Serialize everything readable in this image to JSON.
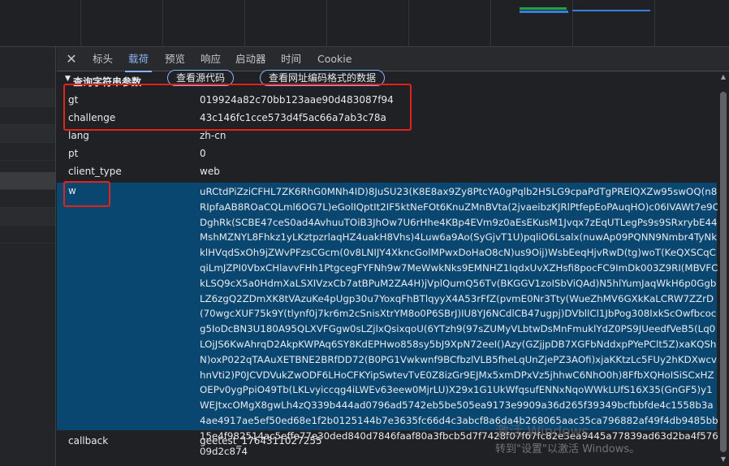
{
  "devtools": {
    "close_icon": "close-icon",
    "tabs": [
      {
        "label": "标头",
        "active": false
      },
      {
        "label": "载荷",
        "active": true
      },
      {
        "label": "预览",
        "active": false
      },
      {
        "label": "响应",
        "active": false
      },
      {
        "label": "启动器",
        "active": false
      },
      {
        "label": "时间",
        "active": false
      },
      {
        "label": "Cookie",
        "active": false
      }
    ]
  },
  "payload": {
    "section_title": "查询字符串参数",
    "view_source_label": "查看源代码",
    "view_url_encoded_label": "查看网址编码格式的数据",
    "params": [
      {
        "key": "gt",
        "value": "019924a82c70bb123aae90d483087f94"
      },
      {
        "key": "challenge",
        "value": "43c146fc1cce573d4f5ac66a7ab3c78a"
      },
      {
        "key": "lang",
        "value": "zh-cn"
      },
      {
        "key": "pt",
        "value": "0"
      },
      {
        "key": "client_type",
        "value": "web"
      },
      {
        "key": "w",
        "value": "uRCtdPiZziCFHL7ZK6RhG0MNh4ID)8JuSU23(K8E8ax9Zy8PtcYA0gPqlb2H5LG9cpaPdTgPRElQXZw95swOQ(n8RIpfaAB8ROaCQLml6OG7L)eGolIQptIt2IF5ktNeFOt6KnuZMnBVta(2jvaeibzKJRlPtfepEoPAuqHO)c06IVAWt7e9CDghRk(SCBE47ceS0ad4AvhuuTOiB3JhOw7U6rHhe4KBp4EVm9z0aEsEKusM1Jvqx7zEqUTLegPs9s9SRxrybE44MshMZNYL8Fhkz1yLKztpzrlaqHZ4uakH8Vhs)4Luw6a9Ao(SyGjvT1U)pqliO6Lsalx(nuwAp09PQNN9Nmbr4TyNkklHVqdSxOh9jZWvPFzsCGcm(0v8LNIJY4XkncGolMPwxDoHaO8cN)us9Oij)WsbEeqHjvRwD(tg)woT(KeQXSCqCqiLmJZPI0VbxCHlavvFHh1PtgcegFYFNh9w7MeWwkNks9EMNHZ1IqdxUvXZHsfi8pocFC9ImDk003Z9RI(MBVFCkLSQ9cX5a0HdmXaLSXIVzxCb7atBPuM2ZA4H)jVplQumQ56Tv(BKGGV1zoISbViQAd)N5hlYumJaqWkH6p0GgbLZ6zgQ2ZDmXK8tVAzuKe4pUgp30u7YoxqFhBTlqyyX4A53rFfZ(pvmE0Nr3Tty(WueZhMV6GXkKaLCRW7ZZrD(70wgcXUF75k9Y(tlynf0j7kr6m2cSnisXtrYM8o0P6SBrJ)IU8YJ6NCdlCB47ugpj)DVbllCl1JbPog308IxkScOwfbcocg5IoDcBN3U180A95QLXVFGgw0sLZjlxQsixqoU(6YTzh9(97sZUMyVLbtwDsMnFmuklYdZ0PS9JUeedfVeB5(Lq0LOjJS6KwAhrqD2AkpKWPAq6SY8KdEPHwo858sy5bJ9XpN72eeI()Azy(GZjjpDB7XGFbNddxpPYePClt5Z)xaKQShN)oxP022qTAAuXETBNE2BRfDD72(B0PG1Vwkwnf9BCfbzlVLB5fheLqUnZjePZ3AOfi)xjaKKtzLc5FUy2hKDXwcvhnVti2)P0JCVDVukZwODF6LHoCFKYipSwtevTvE0Z8izGr9EJMx5xmDPxVz5jhhwC6NhO0h)8FfbXQHoISiSCxHZOEPv0ygPpiO49Tb(LKLvyiccqg4iLWEv63eew0MjrLU)X29x1G1UkWfqsufENNxNqoWWkLUfS16X35(GnGF5)y1WEJtxcOMgX8gwLh4zQ339b444ad0796ad5742eb5be505ea9173e9909a36d265f39349bcfbbfde4c1558b3a4ae4917ae5ef50ed68e1f2b0125144b7e3635fc66d4c3abcf8a6da4b268065aac35ca796882af49f4db9485bb15e4f982514ac5effe77e30ded840d7846faaf80a3fbcb5d7f7428f07f67fc82e3ea9445a77839ad63d2ba4f57609d2c874"
      },
      {
        "key": "callback",
        "value": "geetest_1764311027255"
      }
    ]
  },
  "watermark": {
    "line1": "激活 Windows",
    "line2": "转到\"设置\"以激活 Windows。"
  }
}
